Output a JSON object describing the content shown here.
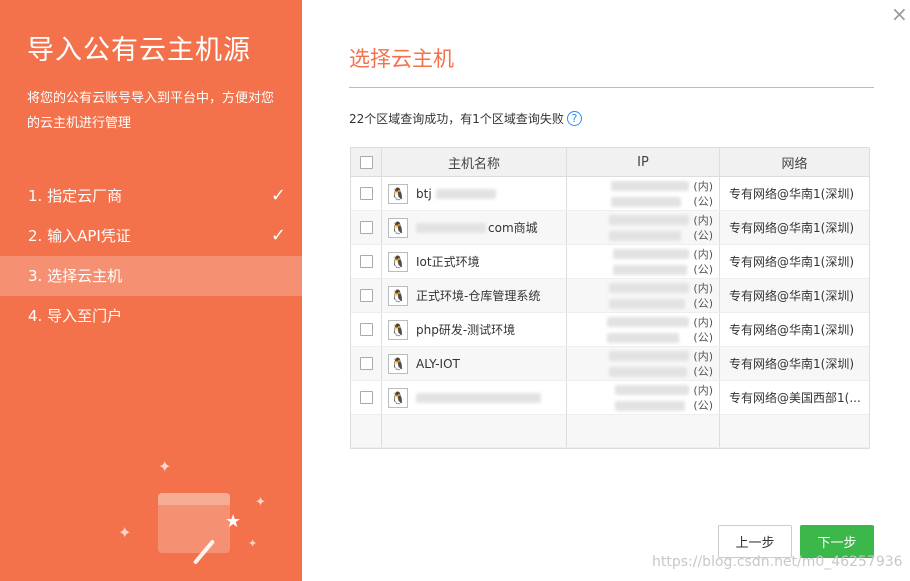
{
  "left": {
    "title": "导入公有云主机源",
    "description": "将您的公有云账号导入到平台中，方便对您的云主机进行管理",
    "steps": [
      {
        "label": "1. 指定云厂商",
        "done": true
      },
      {
        "label": "2. 输入API凭证",
        "done": true
      },
      {
        "label": "3. 选择云主机",
        "done": false,
        "active": true
      },
      {
        "label": "4. 导入至门户",
        "done": false
      }
    ]
  },
  "main": {
    "close_glyph": "×",
    "section_title": "选择云主机",
    "status_text": "22个区域查询成功，有1个区域查询失败",
    "help_glyph": "?",
    "table": {
      "headers": [
        "主机名称",
        "IP",
        "网络"
      ],
      "rows": [
        {
          "name": "btj",
          "ip_internal": "(内)",
          "ip_public": "(公)",
          "network": "专有网络@华南1(深圳)"
        },
        {
          "name": "com商城",
          "ip_internal": "(内)",
          "ip_public": "(公)",
          "network": "专有网络@华南1(深圳)"
        },
        {
          "name": "Iot正式环境",
          "ip_internal": "(内)",
          "ip_public": "(公)",
          "network": "专有网络@华南1(深圳)"
        },
        {
          "name": "正式环境-仓库管理系统",
          "ip_internal": "(内)",
          "ip_public": "(公)",
          "network": "专有网络@华南1(深圳)"
        },
        {
          "name": "php研发-测试环境",
          "ip_internal": "(内)",
          "ip_public": "(公)",
          "network": "专有网络@华南1(深圳)"
        },
        {
          "name": "ALY-IOT",
          "ip_internal": "(内)",
          "ip_public": "(公)",
          "network": "专有网络@华南1(深圳)"
        },
        {
          "name": "",
          "ip_internal": "(内)",
          "ip_public": "(公)",
          "network": "专有网络@美国西部1(..."
        }
      ]
    },
    "buttons": {
      "prev": "上一步",
      "next": "下一步"
    },
    "watermark": "https://blog.csdn.net/m0_46257936"
  },
  "colors": {
    "accent": "#f3714b",
    "primary": "#3cb84a",
    "help": "#2d8cf0"
  },
  "icons": {
    "check": "checkmark-icon",
    "os": "linux-icon",
    "close": "close-icon",
    "help": "help-icon"
  }
}
